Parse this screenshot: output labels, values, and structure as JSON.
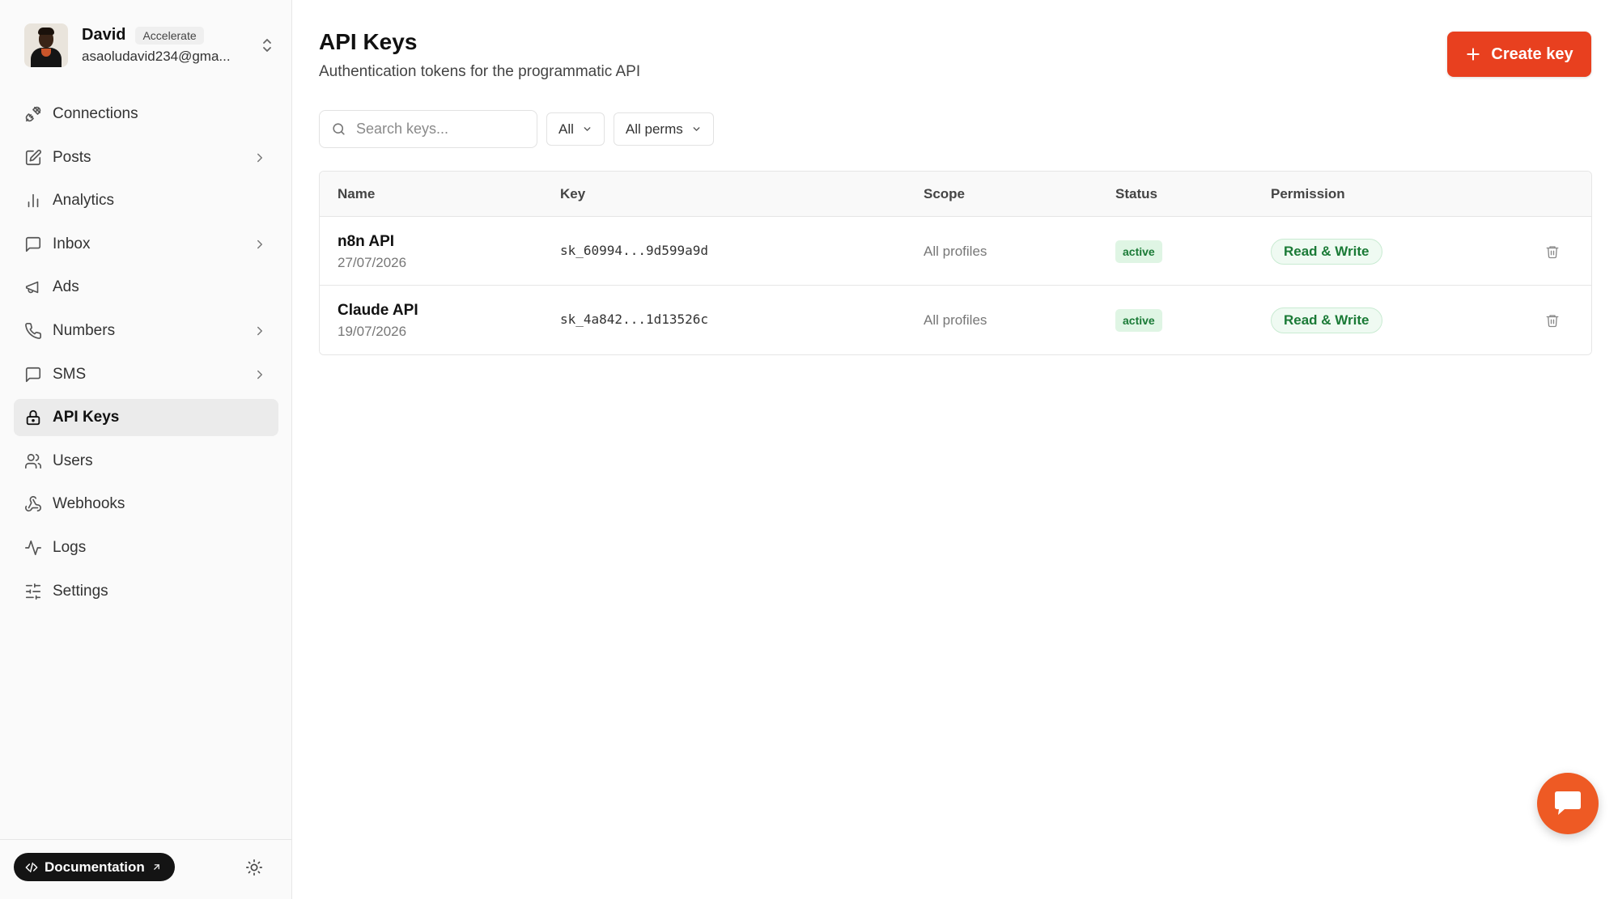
{
  "account": {
    "name": "David",
    "plan": "Accelerate",
    "email": "asaoludavid234@gma..."
  },
  "sidebar": {
    "items": [
      {
        "label": "Connections",
        "icon": "plug-icon",
        "has_chevron": false,
        "active": false
      },
      {
        "label": "Posts",
        "icon": "edit-icon",
        "has_chevron": true,
        "active": false
      },
      {
        "label": "Analytics",
        "icon": "bar-chart-icon",
        "has_chevron": false,
        "active": false
      },
      {
        "label": "Inbox",
        "icon": "message-square-icon",
        "has_chevron": true,
        "active": false
      },
      {
        "label": "Ads",
        "icon": "megaphone-icon",
        "has_chevron": false,
        "active": false
      },
      {
        "label": "Numbers",
        "icon": "phone-icon",
        "has_chevron": true,
        "active": false
      },
      {
        "label": "SMS",
        "icon": "message-square-icon",
        "has_chevron": true,
        "active": false
      },
      {
        "label": "API Keys",
        "icon": "lock-icon",
        "has_chevron": false,
        "active": true
      },
      {
        "label": "Users",
        "icon": "users-icon",
        "has_chevron": false,
        "active": false
      },
      {
        "label": "Webhooks",
        "icon": "webhook-icon",
        "has_chevron": false,
        "active": false
      },
      {
        "label": "Logs",
        "icon": "activity-icon",
        "has_chevron": false,
        "active": false
      },
      {
        "label": "Settings",
        "icon": "sliders-icon",
        "has_chevron": false,
        "active": false
      }
    ],
    "documentation_label": "Documentation"
  },
  "header": {
    "title": "API Keys",
    "subtitle": "Authentication tokens for the programmatic API",
    "create_label": "Create key"
  },
  "filters": {
    "search_placeholder": "Search keys...",
    "status_value": "All",
    "perms_value": "All perms"
  },
  "table": {
    "columns": [
      "Name",
      "Key",
      "Scope",
      "Status",
      "Permission"
    ],
    "rows": [
      {
        "name": "n8n API",
        "date": "27/07/2026",
        "key": "sk_60994...9d599a9d",
        "scope": "All profiles",
        "status": "active",
        "permission": "Read & Write"
      },
      {
        "name": "Claude API",
        "date": "19/07/2026",
        "key": "sk_4a842...1d13526c",
        "scope": "All profiles",
        "status": "active",
        "permission": "Read & Write"
      }
    ]
  },
  "colors": {
    "accent": "#e8401f",
    "chat_button": "#ee5a24",
    "status_green": "#1a7a36"
  }
}
